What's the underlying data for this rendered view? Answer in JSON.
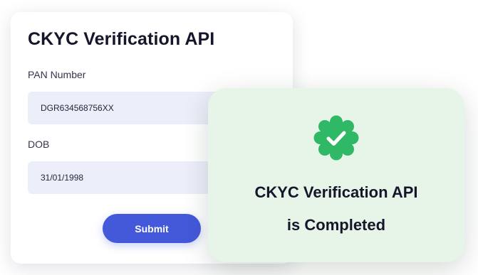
{
  "form": {
    "title": "CKYC Verification API",
    "pan_label": "PAN Number",
    "pan_value": "DGR634568756XX",
    "dob_label": "DOB",
    "dob_value": "31/01/1998",
    "submit_label": "Submit"
  },
  "success": {
    "icon": "verified-check-badge-icon",
    "line1": "CKYC Verification API",
    "line2": "is Completed"
  },
  "colors": {
    "button": "#4459da",
    "field_bg": "#eceefa",
    "success_card_bg": "#e6f5e8",
    "badge_green": "#2fb865"
  }
}
